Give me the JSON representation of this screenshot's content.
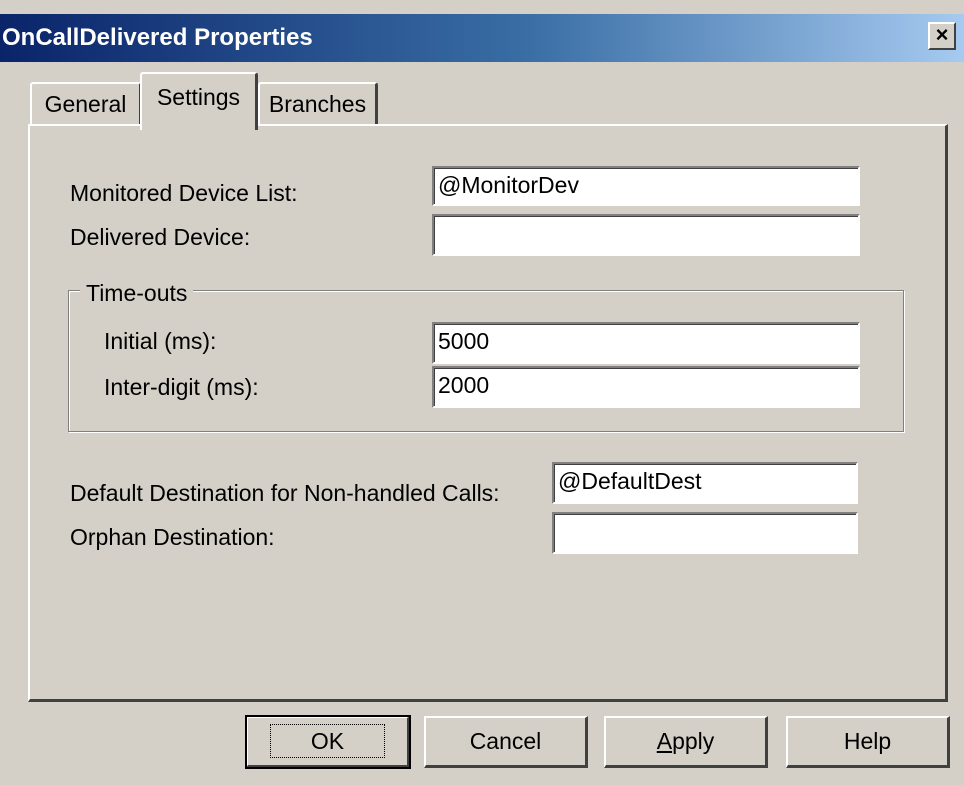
{
  "window": {
    "title": "OnCallDelivered Properties",
    "close_glyph": "×"
  },
  "tabs": [
    {
      "label": "General",
      "active": false
    },
    {
      "label": "Settings",
      "active": true
    },
    {
      "label": "Branches",
      "active": false
    }
  ],
  "settings": {
    "monitored_device_list": {
      "label": "Monitored Device List:",
      "value": "@MonitorDev"
    },
    "delivered_device": {
      "label": "Delivered Device:",
      "value": ""
    },
    "timeouts": {
      "legend": "Time-outs",
      "initial": {
        "label": "Initial (ms):",
        "value": "5000"
      },
      "inter_digit": {
        "label": "Inter-digit (ms):",
        "value": "2000"
      }
    },
    "default_destination": {
      "label": "Default Destination for Non-handled Calls:",
      "value": "@DefaultDest"
    },
    "orphan_destination": {
      "label": "Orphan Destination:",
      "value": ""
    }
  },
  "buttons": {
    "ok": "OK",
    "cancel": "Cancel",
    "apply_prefix": "A",
    "apply_rest": "pply",
    "help": "Help"
  }
}
